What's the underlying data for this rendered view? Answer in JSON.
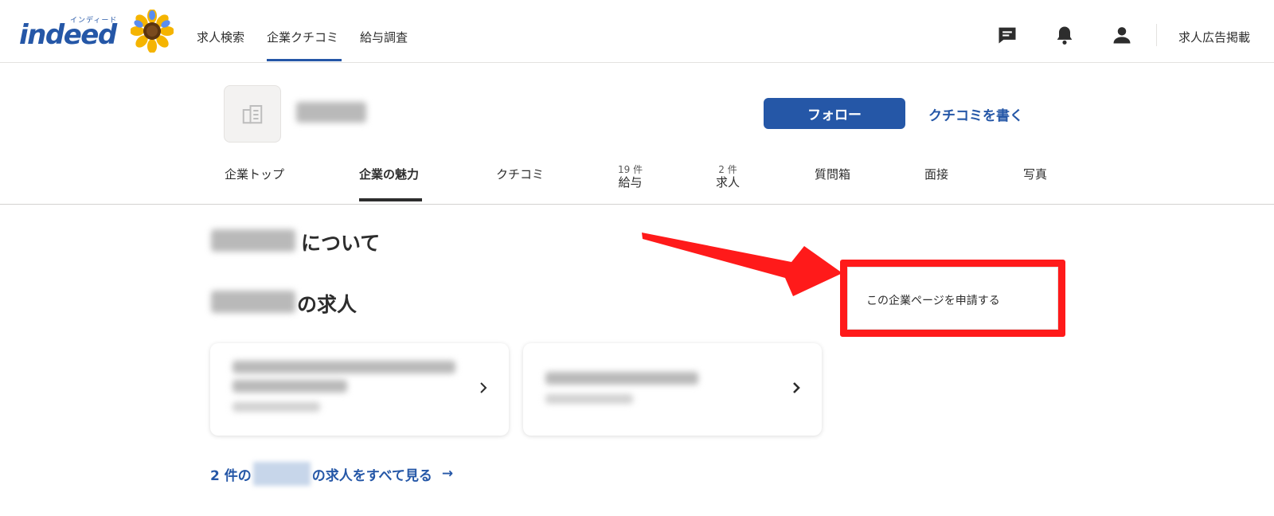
{
  "header": {
    "logo_kana": "インディード",
    "logo_word": "indeed",
    "nav": [
      "求人検索",
      "企業クチコミ",
      "給与調査"
    ],
    "employer_link": "求人広告掲載",
    "icons": [
      "message-icon",
      "bell-icon",
      "person-icon"
    ]
  },
  "company": {
    "follow_label": "フォロー",
    "write_review_label": "クチコミを書く"
  },
  "tabs": [
    {
      "label": "企業トップ",
      "count": ""
    },
    {
      "label": "企業の魅力",
      "count": ""
    },
    {
      "label": "クチコミ",
      "count": ""
    },
    {
      "label": "給与",
      "count": "19 件"
    },
    {
      "label": "求人",
      "count": "2 件"
    },
    {
      "label": "質問箱",
      "count": ""
    },
    {
      "label": "面接",
      "count": ""
    },
    {
      "label": "写真",
      "count": ""
    }
  ],
  "sections": {
    "about_suffix": "について",
    "jobs_suffix": "の求人",
    "all_jobs_prefix": "2 件の",
    "all_jobs_suffix": "の求人をすべて見る",
    "all_jobs_arrow": "→"
  },
  "claim": {
    "label": "この企業ページを申請する"
  },
  "colors": {
    "brand": "#2557a7",
    "annotation": "#ff1a1a"
  }
}
